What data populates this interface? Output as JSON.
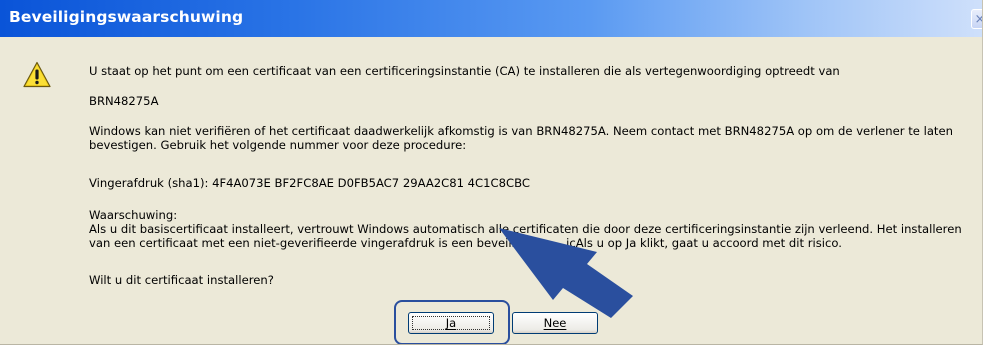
{
  "dialog": {
    "title": "Beveiligingswaarschuwing",
    "close_glyph": "×",
    "icon": "warning-icon"
  },
  "message": {
    "line1": "U staat op het punt om een certificaat van een certificeringsinstantie (CA) te installeren die als vertegenwoordiging optreedt van",
    "ca_name": "BRN48275A",
    "verify_line1": "Windows kan niet verifiëren of het certificaat daadwerkelijk afkomstig is van BRN48275A. Neem contact met BRN48275A op om de verlener te laten",
    "verify_line2": "bevestigen. Gebruik het volgende nummer voor deze procedure:",
    "thumbprint": "Vingerafdruk (sha1): 4F4A073E BF2FC8AE D0FB5AC7 29AA2C81 4C1C8CBC",
    "warning_heading": "Waarschuwing:",
    "warning_line1": "Als u dit basiscertificaat installeert, vertrouwt Windows automatisch alle certificaten die door deze certificeringsinstantie zijn verleend. Het installeren",
    "warning_line2_a": "van een certificaat met een niet-geverifieerde vingerafdruk is een beveilig",
    "warning_line2_b": "icAls u op Ja klikt, gaat u accoord met dit risico.",
    "question": "Wilt u dit certificaat installeren?"
  },
  "buttons": {
    "yes_label": "Ja",
    "no_label": "Nee"
  },
  "colors": {
    "titlebar": "#0a54d8",
    "dialog_bg": "#ece9d8",
    "highlight": "#2a4f9e",
    "arrow": "#2a4f9e"
  }
}
